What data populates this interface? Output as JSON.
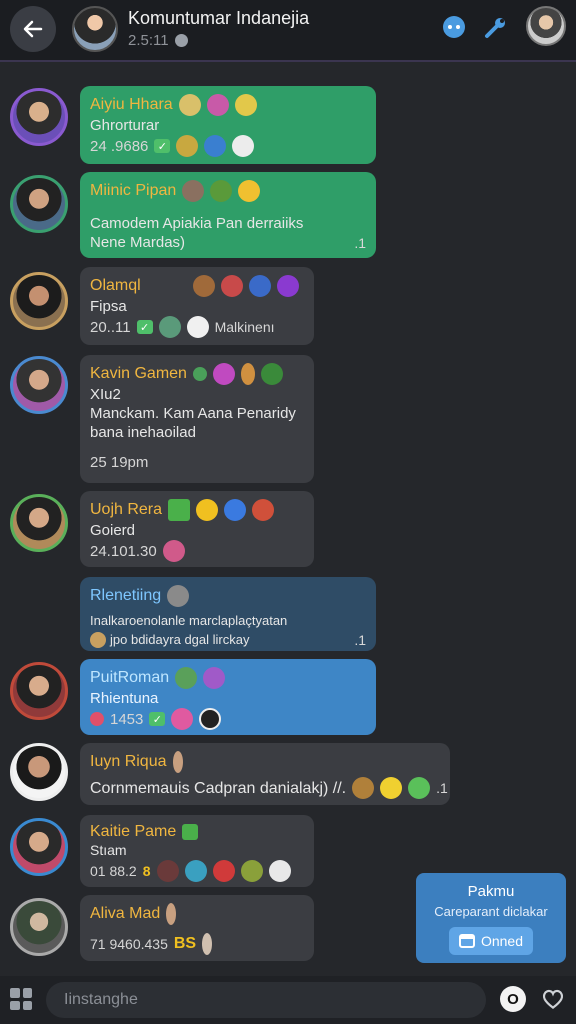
{
  "header": {
    "title": "Komuntumar Indanejia",
    "subtitle": "2.5:11",
    "icons": [
      "back-arrow-icon",
      "status-dot-icon",
      "chat-bubble-icon",
      "wrench-icon"
    ],
    "accent": "#3b3550"
  },
  "messages": [
    {
      "name": "Aiyiu Hhara",
      "line1": "Ghrorturar",
      "meta": "24 .9686",
      "style": "green"
    },
    {
      "name": "Miinic Pipan",
      "line1": "Camodem Apiakia Pan derraiiks",
      "line2": "Nene Mardas)",
      "tick": ".1",
      "style": "green"
    },
    {
      "name": "Olamql",
      "line1": "Fipsa",
      "meta": "20..11",
      "extra": "Malkinenı",
      "style": "dark"
    },
    {
      "name": "Kavin Gamen",
      "line1": "XIu2",
      "line2": "Manckam. Kam Aana Penaridy",
      "line3": "bana inehaoilad",
      "meta": "25 19pm",
      "style": "dark"
    },
    {
      "name": "Uojh Rera",
      "line1": "Goierd",
      "meta": "24.101.30",
      "style": "dark"
    },
    {
      "name": "Rlenetiing",
      "line1": "Inalkaroenolanle marclaplaçtyatan",
      "line2": "jpo bdidayra dgal lirckay",
      "tick": ".1",
      "style": "blue-dark"
    },
    {
      "name": "PuitRoman",
      "line1": "Rhientuna",
      "meta": "1453",
      "style": "blue"
    },
    {
      "name": "Iuyn Riqua",
      "line1": "Cornmemauis Cadpran danialakj) //.",
      "tick": ".1",
      "style": "dark"
    },
    {
      "name": "Kaitie Pame",
      "line1": "Stıam",
      "meta": "01 88.2",
      "badge": "8",
      "style": "dark"
    },
    {
      "name": "Aliva Mad",
      "meta": "71 9460.435",
      "badge": "BS",
      "style": "dark"
    }
  ],
  "card": {
    "title": "Pakmu",
    "subtitle": "Careparant diclakar",
    "button": "Onned"
  },
  "composer": {
    "placeholder": "Iinstanghe",
    "send_label": "O"
  },
  "colors": {
    "green": "#2f9e68",
    "dark": "#3b3d42",
    "blue": "#3e86c6",
    "name": "#f0b640"
  }
}
